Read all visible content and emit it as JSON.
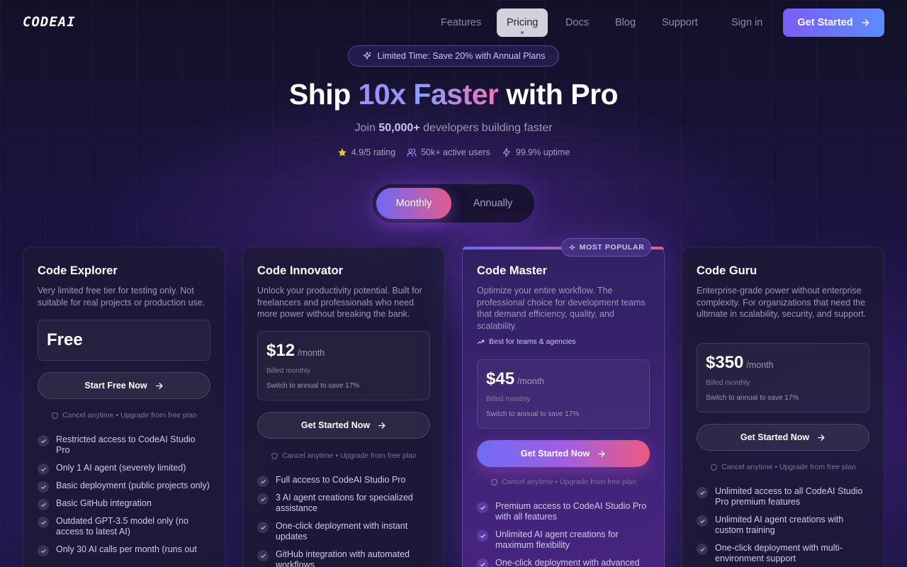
{
  "nav": {
    "logo": "CODEAI",
    "links": [
      "Features",
      "Pricing",
      "Docs",
      "Blog",
      "Support"
    ],
    "sign_in": "Sign in",
    "cta": "Get Started"
  },
  "hero": {
    "promo": "Limited Time: Save 20% with Annual Plans",
    "title_pre": "Ship ",
    "title_highlight": "10x Faster",
    "title_post": " with Pro",
    "subtitle_pre": "Join ",
    "subtitle_bold": "50,000+",
    "subtitle_post": " developers building faster",
    "stats": [
      "4.9/5 rating",
      "50k+ active users",
      "99.9% uptime"
    ]
  },
  "billing_toggle": {
    "options": [
      "Monthly",
      "Annually"
    ],
    "selected": "Monthly"
  },
  "popular_badge": "MOST POPULAR",
  "plans": [
    {
      "name": "Code Explorer",
      "description": "Very limited free tier for testing only. Not suitable for real projects or production use.",
      "price": "Free",
      "button": "Start Free Now",
      "note": "Cancel anytime • Upgrade from free plan",
      "features": [
        "Restricted access to CodeAI Studio Pro",
        "Only 1 AI agent (severely limited)",
        "Basic deployment (public projects only)",
        "Basic GitHub integration",
        "Outdated GPT-3.5 model only (no access to latest AI)",
        "Only 30 AI calls per month (runs out"
      ]
    },
    {
      "name": "Code Innovator",
      "description": "Unlock your productivity potential. Built for freelancers and professionals who need more power without breaking the bank.",
      "price": "$12",
      "period": "/month",
      "billed": "Billed monthly",
      "save": "Switch to annual to save 17%",
      "button": "Get Started Now",
      "note": "Cancel anytime • Upgrade from free plan",
      "features": [
        "Full access to CodeAI Studio Pro",
        "3 AI agent creations for specialized assistance",
        "One-click deployment with instant updates",
        "GitHub integration with automated workflows"
      ]
    },
    {
      "name": "Code Master",
      "description": "Optimize your entire workflow. The professional choice for development teams that demand efficiency, quality, and scalability.",
      "best_for": "Best for teams & agencies",
      "price": "$45",
      "period": "/month",
      "billed": "Billed monthly",
      "save": "Switch to annual to save 17%",
      "button": "Get Started Now",
      "note": "Cancel anytime • Upgrade from free plan",
      "features": [
        "Premium access to CodeAI Studio Pro with all features",
        "Unlimited AI agent creations for maximum flexibility",
        "One-click deployment with advanced"
      ]
    },
    {
      "name": "Code Guru",
      "description": "Enterprise-grade power without enterprise complexity. For organizations that need the ultimate in scalability, security, and support.",
      "price": "$350",
      "period": "/month",
      "billed": "Billed monthly",
      "save": "Switch to annual to save 17%",
      "button": "Get Started Now",
      "note": "Cancel anytime • Upgrade from free plan",
      "features": [
        "Unlimited access to all CodeAI Studio Pro premium features",
        "Unlimited AI agent creations with custom training",
        "One-click deployment with multi-environment support"
      ]
    }
  ],
  "colors": {
    "accent_purple": "#7c5cf6",
    "accent_pink": "#e25c8c",
    "background": "#12112a"
  }
}
